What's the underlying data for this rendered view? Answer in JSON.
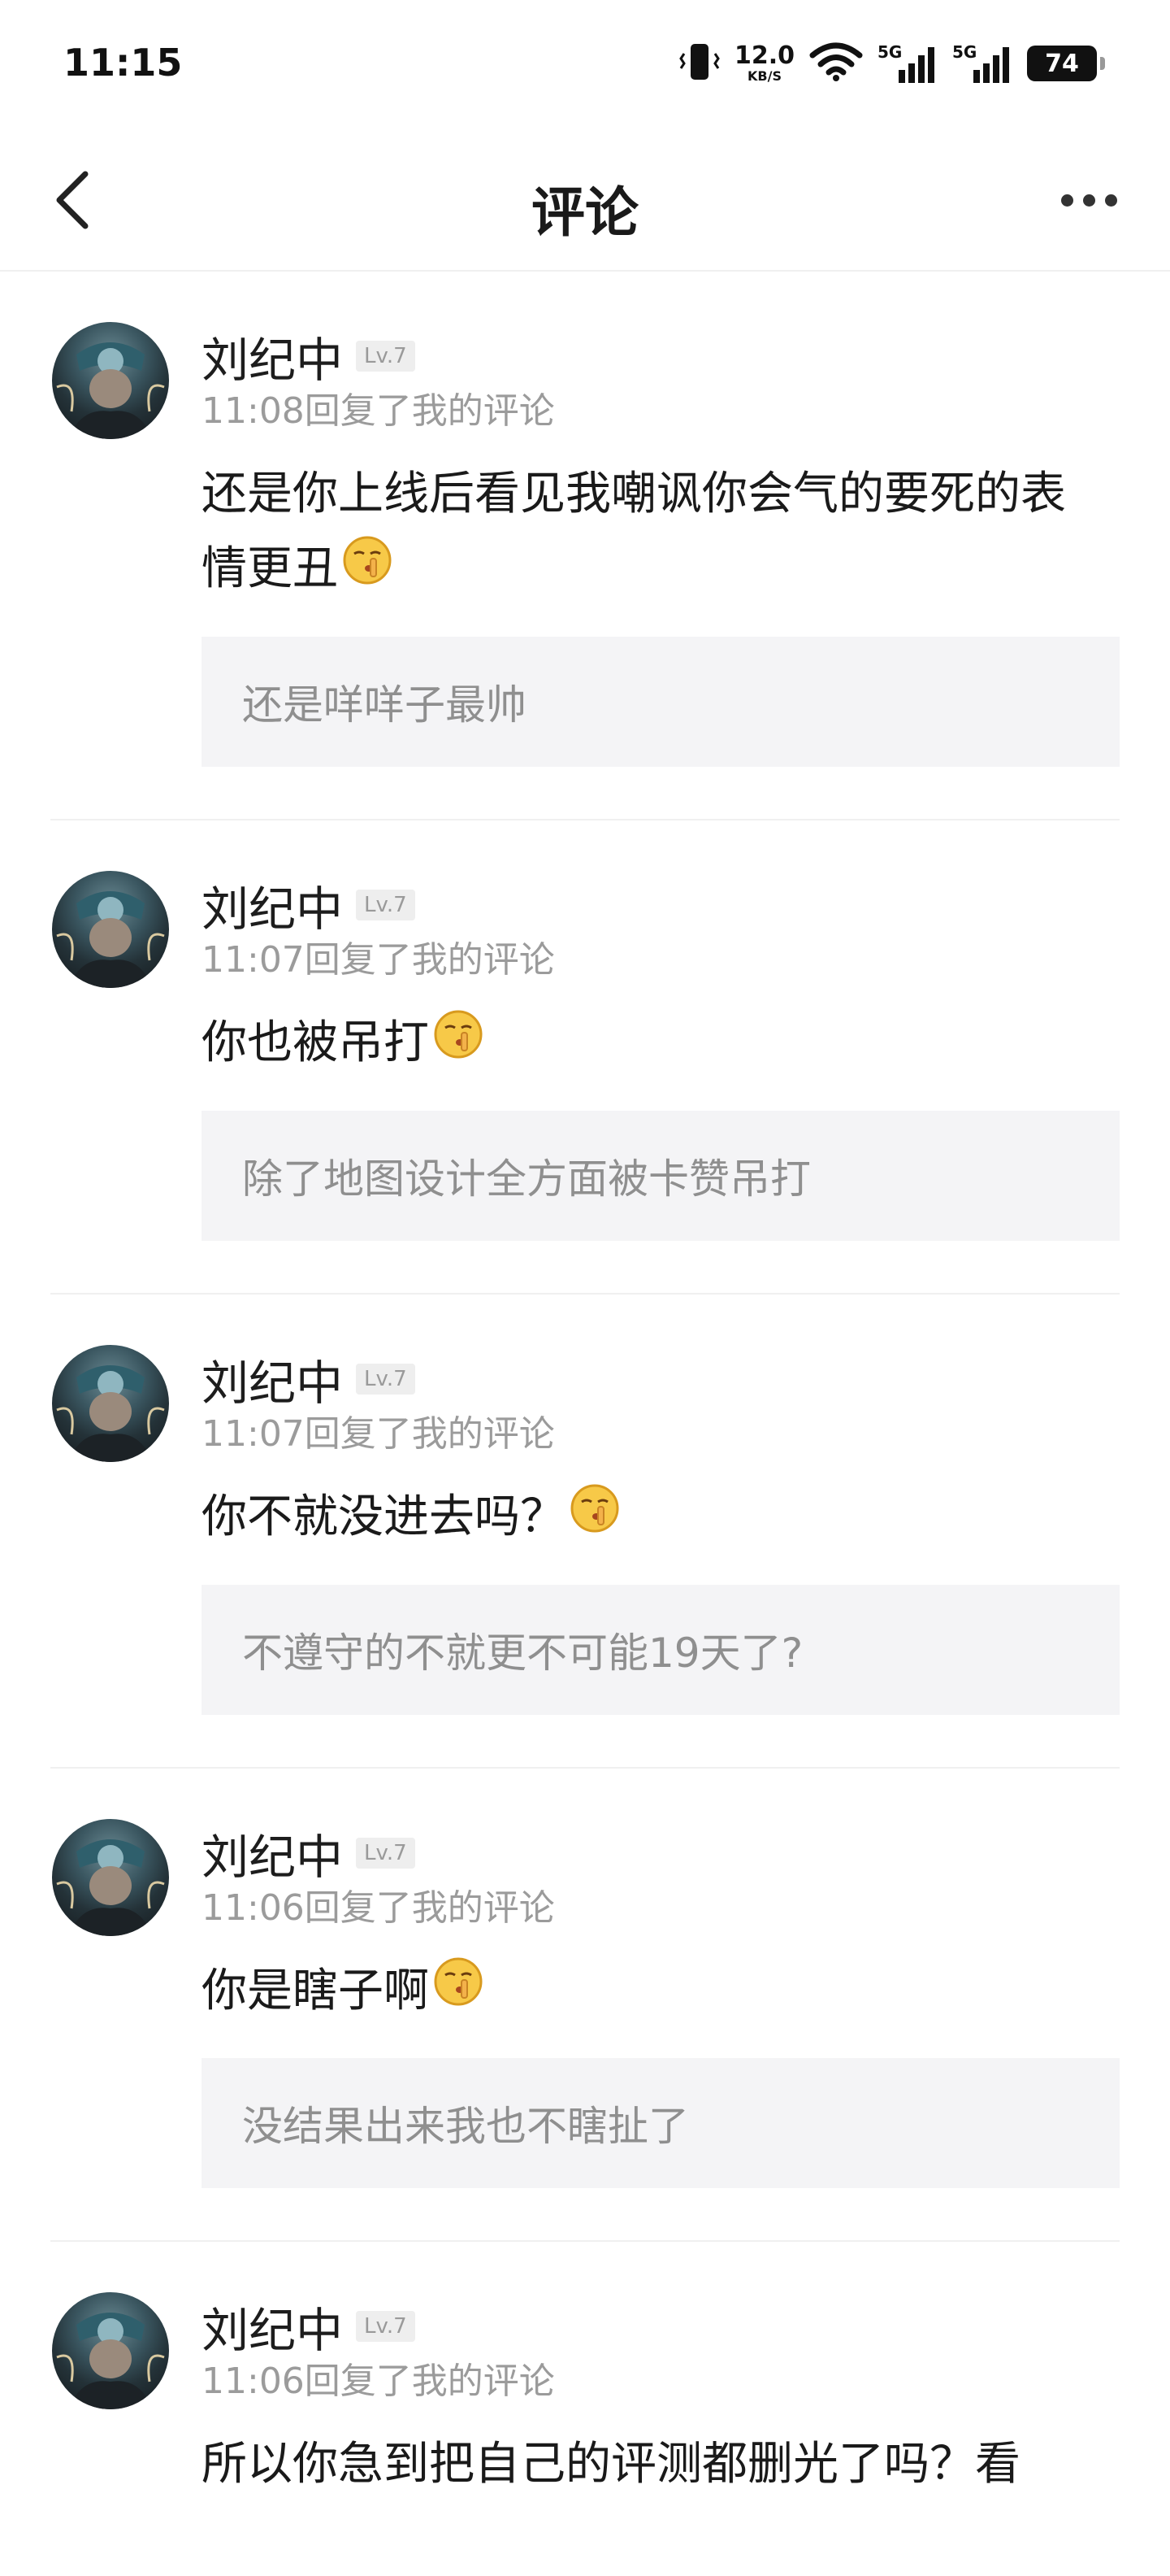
{
  "status_bar": {
    "time": "11:15",
    "net_speed_value": "12.0",
    "net_speed_unit": "KB/S",
    "signal1": "5G",
    "signal2": "5G",
    "battery": "74"
  },
  "nav": {
    "title": "评论"
  },
  "comments": [
    {
      "username": "刘纪中",
      "level": "Lv.7",
      "meta": "11:08回复了我的评论",
      "text": "还是你上线后看见我嘲讽你会气的要死的表情更丑",
      "emoji": "shush-emoji",
      "quote": "还是咩咩子最帅"
    },
    {
      "username": "刘纪中",
      "level": "Lv.7",
      "meta": "11:07回复了我的评论",
      "text": "你也被吊打",
      "emoji": "shush-emoji",
      "quote": "除了地图设计全方面被卡赞吊打"
    },
    {
      "username": "刘纪中",
      "level": "Lv.7",
      "meta": "11:07回复了我的评论",
      "text": "你不就没进去吗？",
      "emoji": "shush-emoji",
      "quote": "不遵守的不就更不可能19天了?"
    },
    {
      "username": "刘纪中",
      "level": "Lv.7",
      "meta": "11:06回复了我的评论",
      "text": "你是瞎子啊",
      "emoji": "shush-emoji",
      "quote": "没结果出来我也不瞎扯了"
    },
    {
      "username": "刘纪中",
      "level": "Lv.7",
      "meta": "11:06回复了我的评论",
      "text": "所以你急到把自己的评测都删光了吗？看",
      "emoji": "",
      "quote": ""
    }
  ]
}
